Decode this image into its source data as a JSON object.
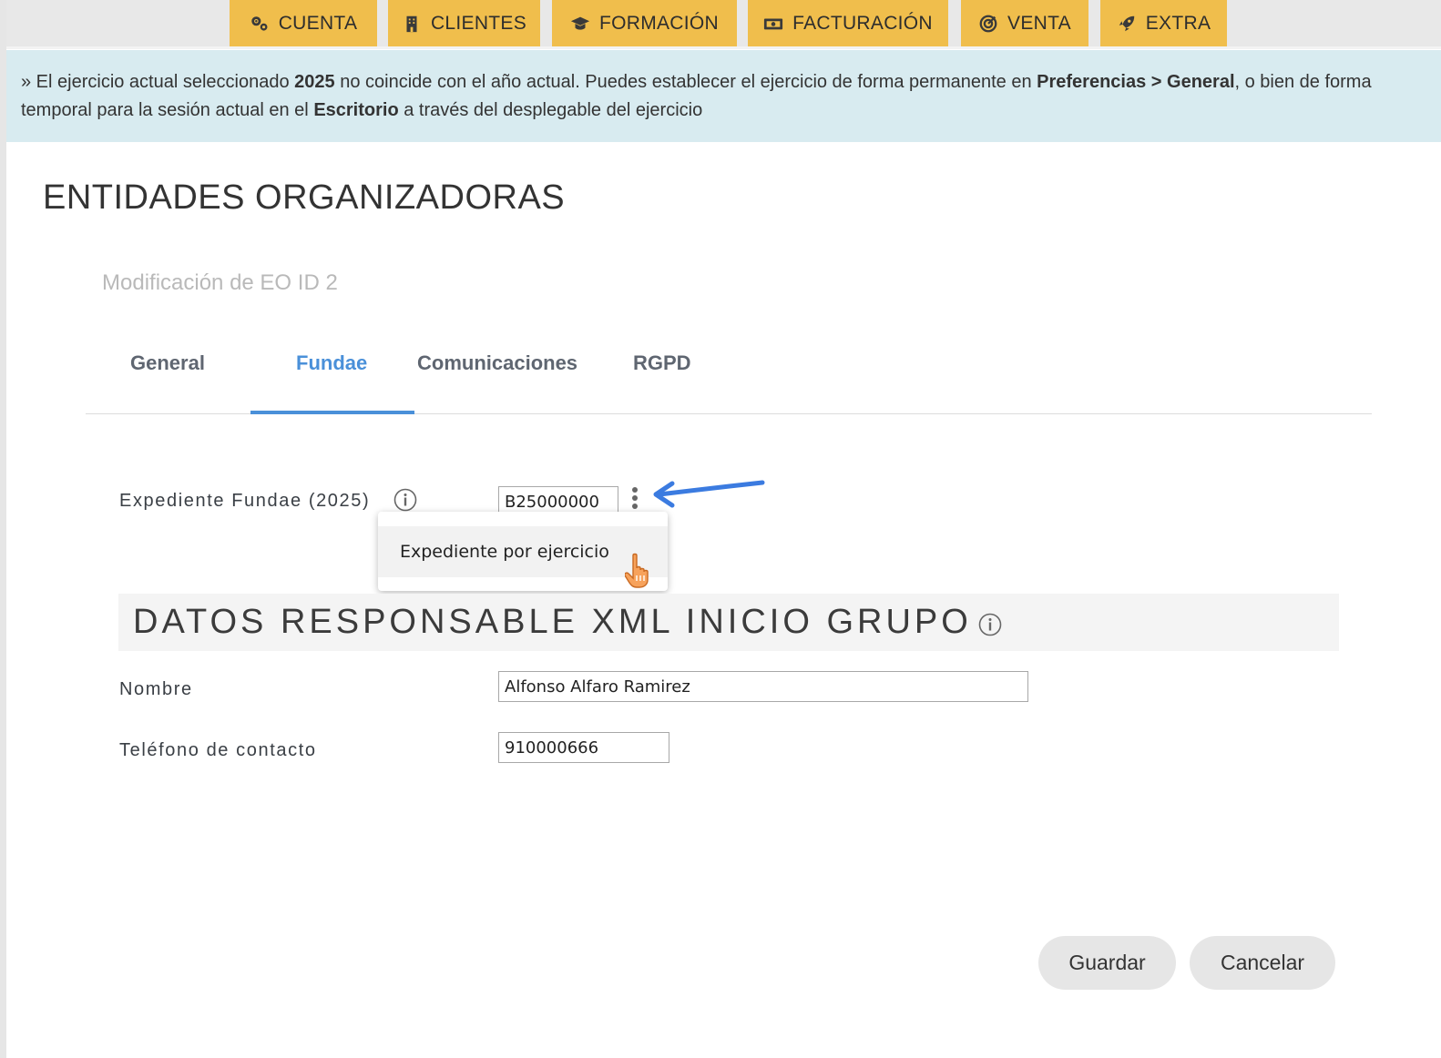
{
  "nav": {
    "items": [
      {
        "label": "CUENTA",
        "icon": "gears-icon"
      },
      {
        "label": "CLIENTES",
        "icon": "building-icon"
      },
      {
        "label": "FORMACIÓN",
        "icon": "graduation-cap-icon"
      },
      {
        "label": "FACTURACIÓN",
        "icon": "money-icon"
      },
      {
        "label": "VENTA",
        "icon": "target-icon"
      },
      {
        "label": "EXTRA",
        "icon": "rocket-icon"
      }
    ],
    "color": "#f0be4c"
  },
  "notice": {
    "prefix": "» El ejercicio actual seleccionado ",
    "year": "2025",
    "mid": " no coincide con el año actual. Puedes establecer el ejercicio de forma permanente en ",
    "prefs": "Preferencias > General",
    "mid2": ", o bien de forma temporal para la sesión actual en el ",
    "desk": "Escritorio",
    "suffix": " a través del desplegable del ejercicio"
  },
  "page": {
    "title": "ENTIDADES ORGANIZADORAS",
    "subtitle": "Modificación de EO ID 2"
  },
  "tabs": [
    {
      "label": "General",
      "active": false
    },
    {
      "label": "Fundae",
      "active": true
    },
    {
      "label": "Comunicaciones",
      "active": false
    },
    {
      "label": "RGPD",
      "active": false
    }
  ],
  "form": {
    "expediente_label": "Expediente Fundae (2025)",
    "expediente_value": "B25000000",
    "menu_item": "Expediente por ejercicio",
    "section_title": "DATOS RESPONSABLE XML INICIO GRUPO",
    "nombre_label": "Nombre",
    "nombre_value": "Alfonso Alfaro Ramirez",
    "telefono_label": "Teléfono de contacto",
    "telefono_value": "910000666"
  },
  "buttons": {
    "save": "Guardar",
    "cancel": "Cancelar"
  },
  "colors": {
    "accent": "#4a90d9",
    "arrow": "#3b7be0",
    "notice_bg": "#d8ebf0"
  }
}
